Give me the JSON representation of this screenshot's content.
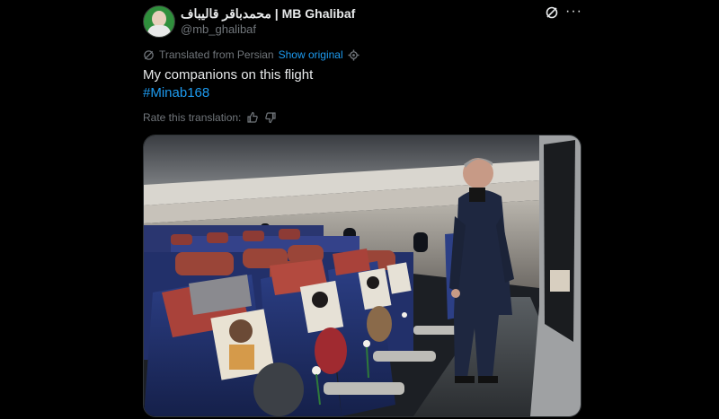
{
  "author": {
    "display_name": "محمدباقر قالیباف | MB Ghalibaf",
    "handle": "@mb_ghalibaf"
  },
  "translation": {
    "label": "Translated from Persian",
    "show_original": "Show original"
  },
  "post": {
    "text": "My companions on this flight",
    "hashtag": "#Minab168"
  },
  "rate": {
    "label": "Rate this translation:"
  },
  "colors": {
    "background": "#000000",
    "link": "#1d9bf0",
    "muted": "#71767b",
    "text": "#e7e9ea"
  },
  "icons": [
    "grok-icon",
    "more-icon",
    "translate-icon",
    "gear-icon",
    "thumbs-up-icon",
    "thumbs-down-icon"
  ]
}
